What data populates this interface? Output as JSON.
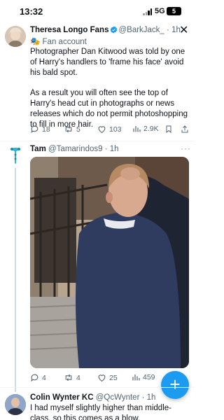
{
  "status_bar": {
    "time": "13:32",
    "network": "5G",
    "battery": "5"
  },
  "tweets": [
    {
      "name": "Theresa Longo Fans",
      "handle": "@BarkJack_",
      "time": "· 1h",
      "badge": "Fan account",
      "text": [
        "Photographer Dan Kitwood was told by one of Harry's handlers to 'frame his face' avoid his bald spot.",
        "As a result you will often see the top of Harry's head cut in photographs or news releases which do not permit photoshopping to fill in more hair."
      ],
      "replies": "18",
      "retweets": "5",
      "likes": "103",
      "views": "2.9K"
    },
    {
      "name": "Tam",
      "handle": "@Tamarindos9",
      "time": "· 1h",
      "replies": "4",
      "retweets": "4",
      "likes": "25",
      "views": "459"
    },
    {
      "name": "Colin Wynter KC",
      "handle": "@QcWynter",
      "time": "· 1h",
      "text": [
        "I had myself slightly higher than middle-class, so this comes as a blow."
      ]
    }
  ],
  "colors": {
    "accent": "#1d9bf0",
    "text": "#0f1419",
    "muted": "#536471"
  }
}
